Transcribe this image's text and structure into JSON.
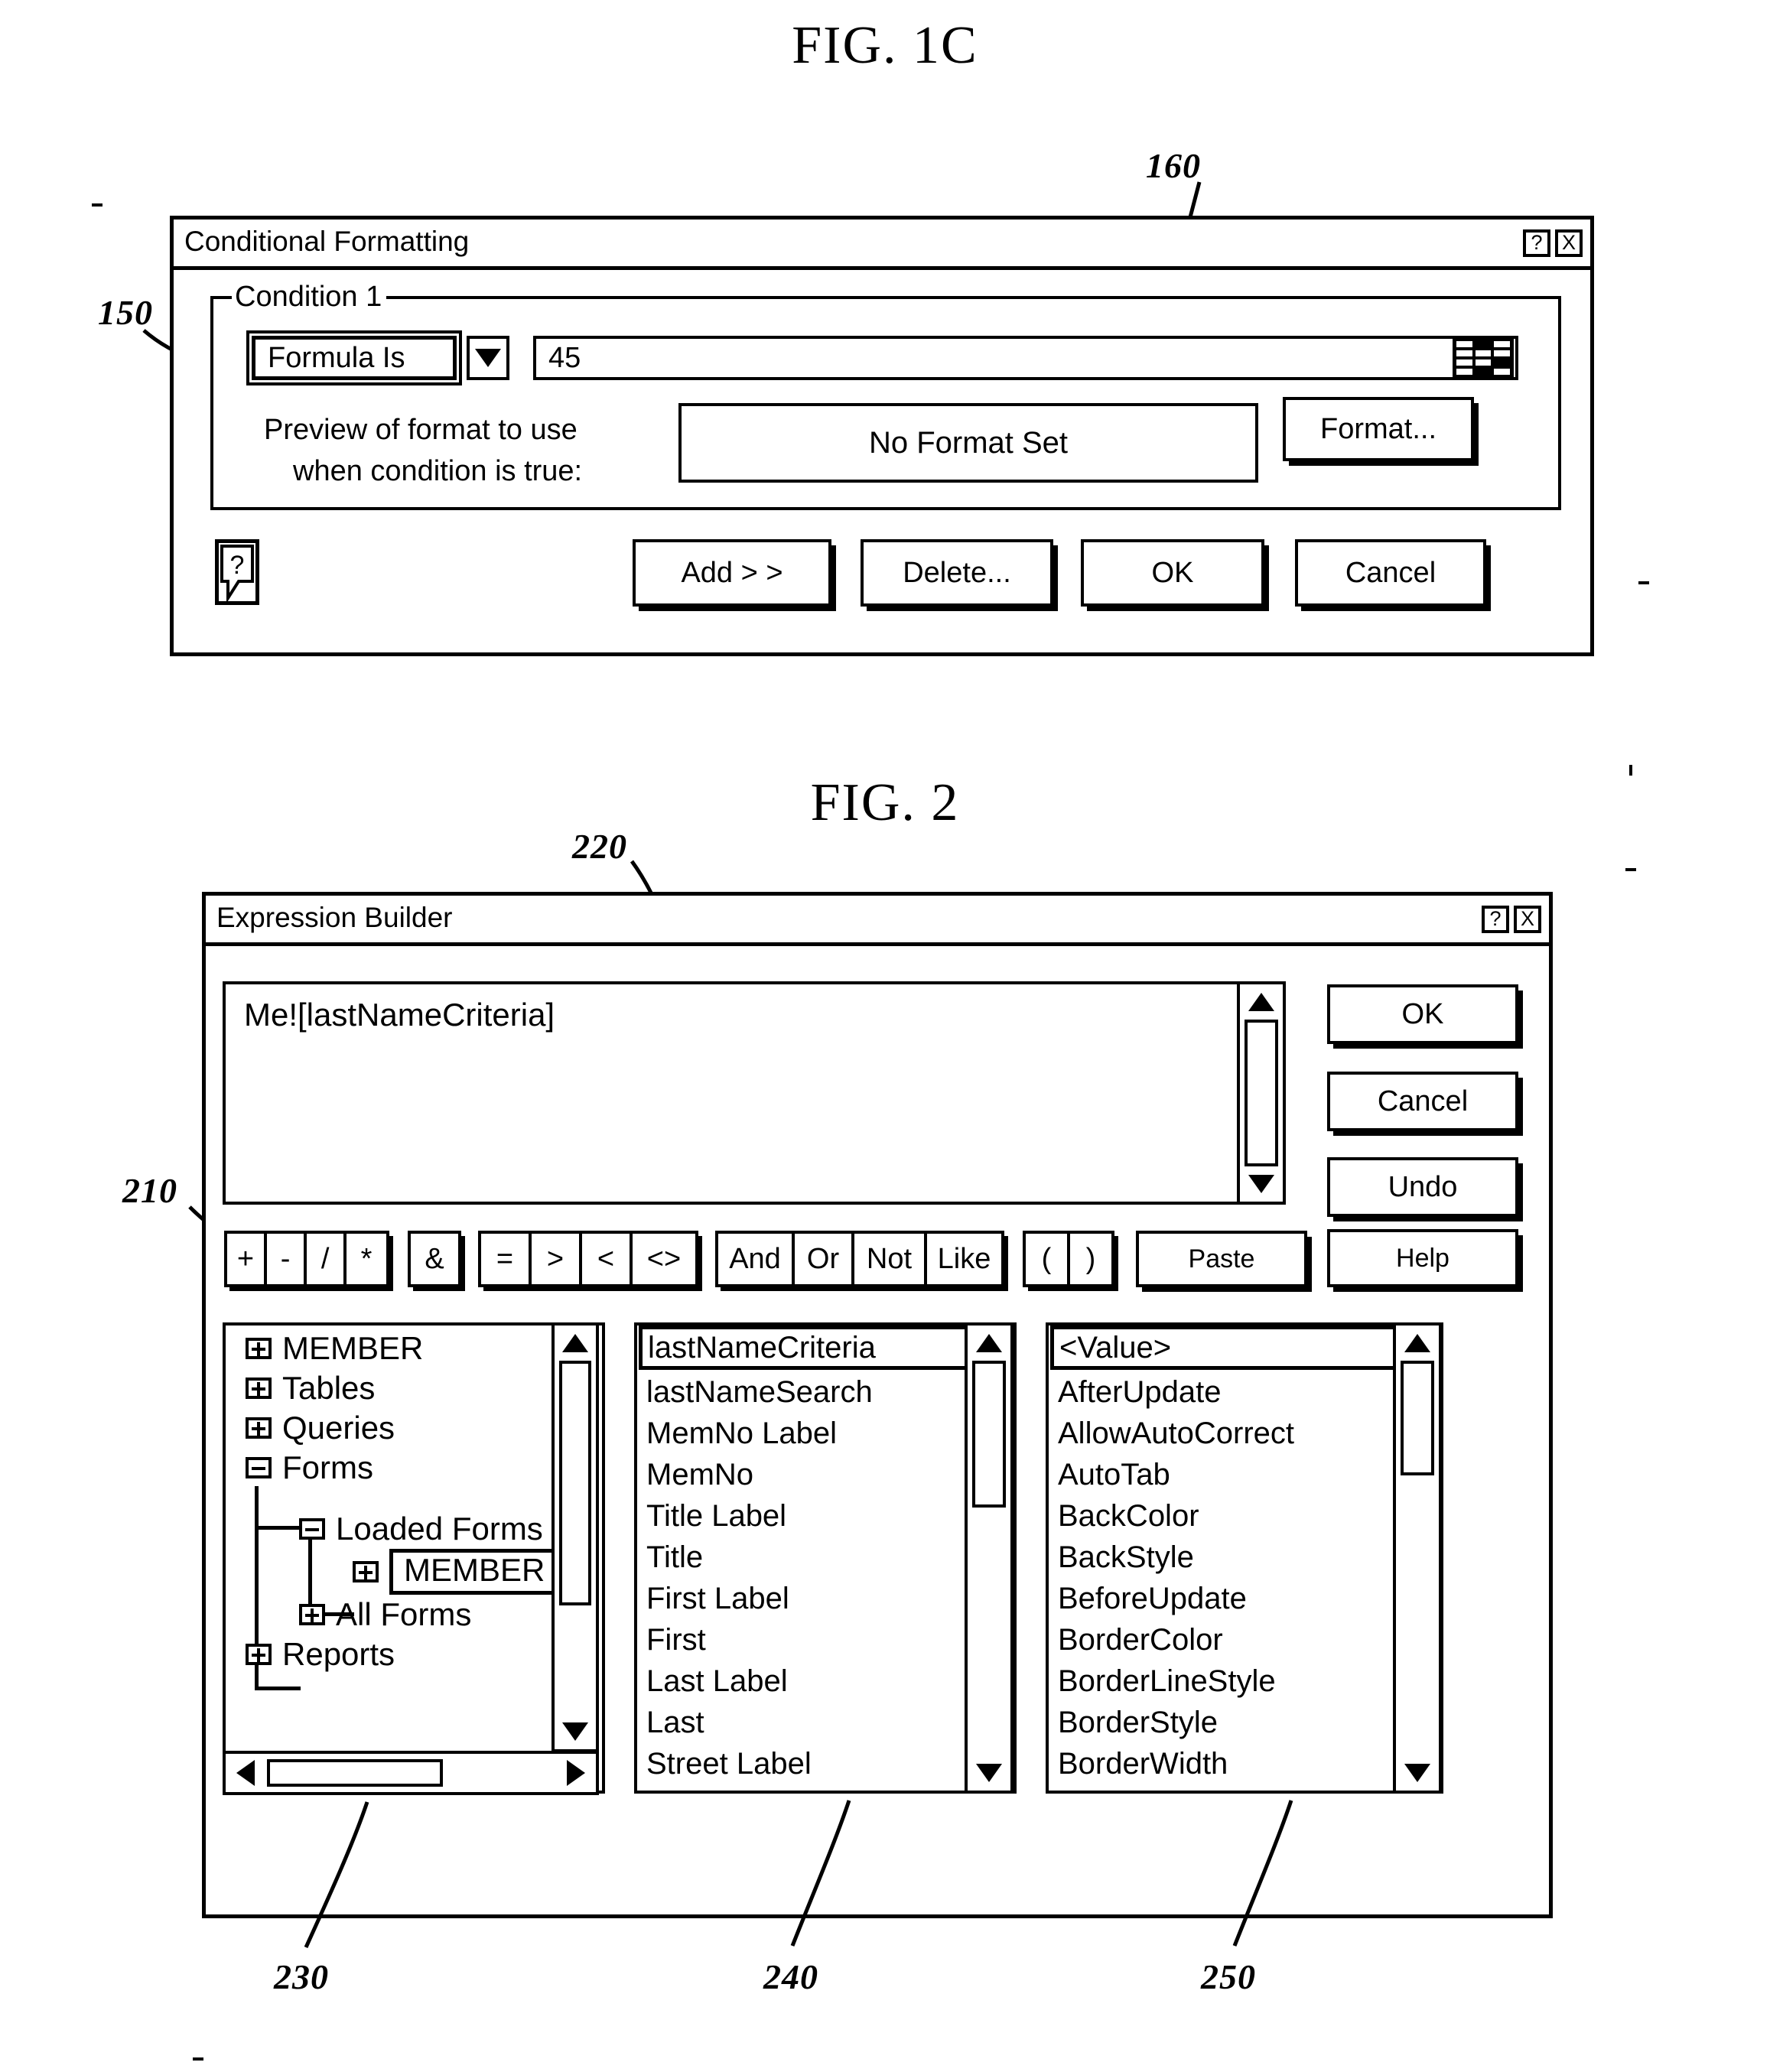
{
  "page": {
    "fig1c_caption": "FIG. 1C",
    "fig2_caption": "FIG. 2"
  },
  "refs": {
    "r150": "150",
    "r160": "160",
    "r210": "210",
    "r220": "220",
    "r230": "230",
    "r240": "240",
    "r250": "250"
  },
  "conditional_formatting": {
    "title": "Conditional Formatting",
    "help_btn": "?",
    "close_btn": "X",
    "group_legend": "Condition 1",
    "condition_type": "Formula Is",
    "condition_value": "45",
    "builder_icon": "build-icon",
    "preview_label_line1": "Preview of format to use",
    "preview_label_line2": "when condition is true:",
    "preview_value": "No Format Set",
    "format_button": "Format...",
    "help_icon_btn": "?",
    "buttons": [
      "Add > >",
      "Delete...",
      "OK",
      "Cancel"
    ]
  },
  "expression_builder": {
    "title": "Expression Builder",
    "help_btn": "?",
    "close_btn": "X",
    "expression_text": "Me![lastNameCriteria]",
    "side_buttons": [
      "OK",
      "Cancel",
      "Undo"
    ],
    "operator_groups": [
      {
        "name": "arithmetic",
        "keys": [
          "+",
          "-",
          "/",
          "*"
        ]
      },
      {
        "name": "concat",
        "keys": [
          "&"
        ]
      },
      {
        "name": "comparison",
        "keys": [
          "=",
          ">",
          "<",
          "<>"
        ]
      },
      {
        "name": "logical",
        "keys": [
          "And",
          "Or",
          "Not",
          "Like"
        ]
      },
      {
        "name": "parens",
        "keys": [
          "(",
          ")"
        ]
      }
    ],
    "paste_button": "Paste",
    "help_button": "Help",
    "tree": {
      "nodes": [
        {
          "label": "MEMBER",
          "icon": "folder-plus-icon",
          "depth": 0
        },
        {
          "label": "Tables",
          "icon": "folder-plus-icon",
          "depth": 0
        },
        {
          "label": "Queries",
          "icon": "folder-plus-icon",
          "depth": 0
        },
        {
          "label": "Forms",
          "icon": "folder-open-icon",
          "depth": 0
        },
        {
          "label": "Loaded Forms",
          "icon": "folder-open-icon",
          "depth": 1
        },
        {
          "label": "MEMBER",
          "icon": "folder-plus-icon",
          "depth": 2,
          "selected": true
        },
        {
          "label": "All Forms",
          "icon": "folder-plus-icon",
          "depth": 1
        },
        {
          "label": "Reports",
          "icon": "folder-plus-icon",
          "depth": 0
        }
      ]
    },
    "controls_list": {
      "selected": "lastNameCriteria",
      "items": [
        "lastNameCriteria",
        "lastNameSearch",
        "MemNo Label",
        "MemNo",
        "Title Label",
        "Title",
        "First Label",
        "First",
        "Last Label",
        "Last",
        "Street Label"
      ]
    },
    "properties_list": {
      "selected": "<Value>",
      "items": [
        "<Value>",
        "AfterUpdate",
        "AllowAutoCorrect",
        "AutoTab",
        "BackColor",
        "BackStyle",
        "BeforeUpdate",
        "BorderColor",
        "BorderLineStyle",
        "BorderStyle",
        "BorderWidth"
      ]
    }
  }
}
